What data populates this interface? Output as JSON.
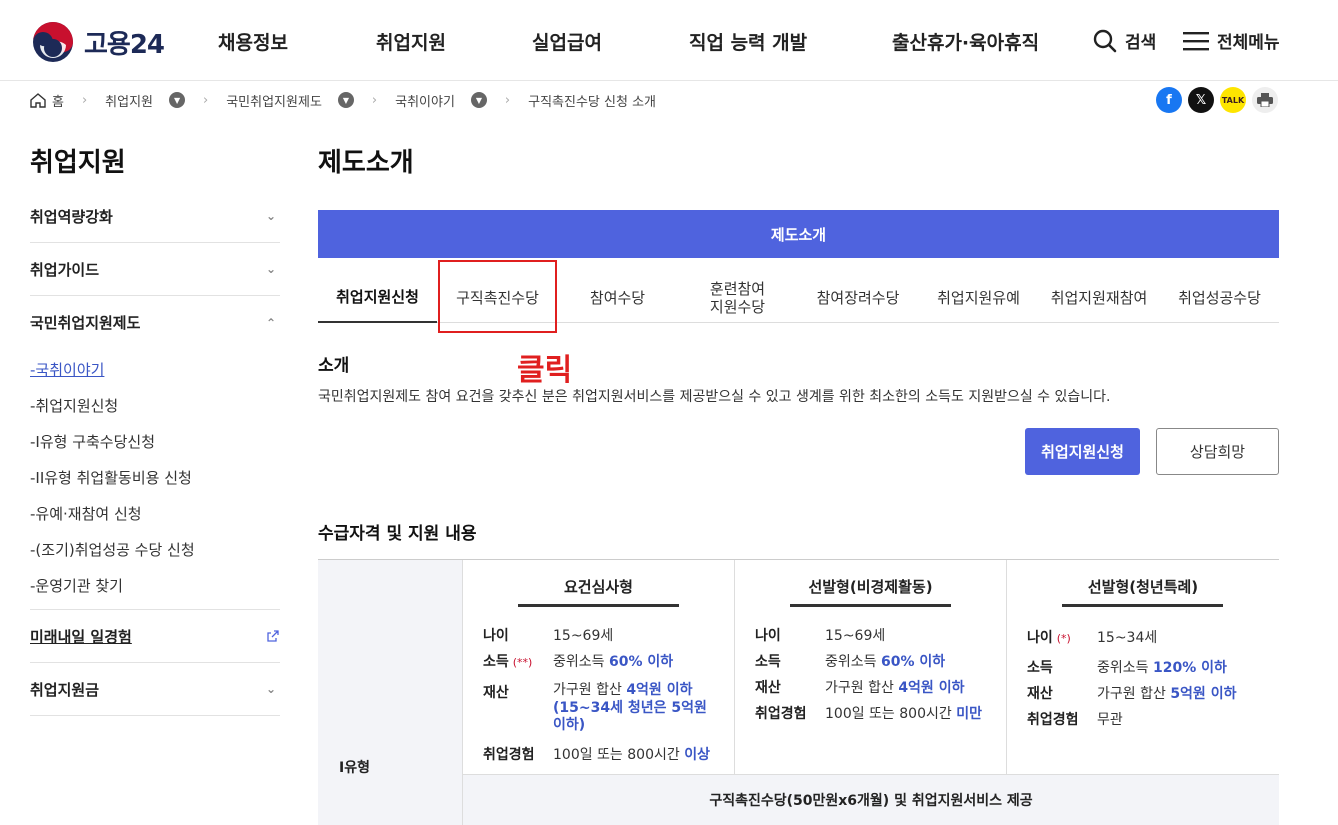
{
  "header": {
    "logo_text": "고용24",
    "nav": [
      "채용정보",
      "취업지원",
      "실업급여",
      "직업 능력 개발",
      "출산휴가·육아휴직"
    ],
    "search_label": "검색",
    "menu_label": "전체메뉴"
  },
  "breadcrumb": {
    "home": "홈",
    "items": [
      "취업지원",
      "국민취업지원제도",
      "국취이야기",
      "구직촉진수당 신청 소개"
    ]
  },
  "sidebar": {
    "title": "취업지원",
    "items": [
      {
        "label": "취업역량강화"
      },
      {
        "label": "취업가이드"
      },
      {
        "label": "국민취업지원제도"
      },
      {
        "label": "미래내일 일경험"
      },
      {
        "label": "취업지원금"
      }
    ],
    "sub_items": [
      "-국취이야기",
      "-취업지원신청",
      "-I유형 구축수당신청",
      "-II유형 취업활동비용 신청",
      "-유예·재참여 신청",
      "-(조기)취업성공 수당 신청",
      "-운영기관 찾기"
    ]
  },
  "main": {
    "title": "제도소개",
    "bar_label": "제도소개",
    "tabs": [
      "취업지원신청",
      "구직촉진수당",
      "참여수당",
      "훈련참여\n지원수당",
      "참여장려수당",
      "취업지원유예",
      "취업지원재참여",
      "취업성공수당"
    ],
    "annotation": "클릭",
    "intro_heading": "소개",
    "intro_text": "국민취업지원제도 참여 요건을 갖추신 분은 취업지원서비스를 제공받으실 수 있고 생계를 위한 최소한의 소득도 지원받으실 수 있습니다.",
    "apply_button": "취업지원신청",
    "consult_button": "상담희망",
    "qualification_heading": "수급자격 및 지원 내용"
  },
  "table": {
    "row_head": "I유형",
    "columns": [
      {
        "title": "요건심사형",
        "age_label": "나이",
        "age": "15~69세",
        "income_label": "소득",
        "income_mark": "(**)",
        "income_pre": "중위소득 ",
        "income_hl": "60% 이하",
        "asset_label": "재산",
        "asset_pre": "가구원 합산 ",
        "asset_hl": "4억원 이하",
        "asset_note": "(15~34세 청년은 5억원 이하)",
        "exp_label": "취업경험",
        "exp_pre": "100일 또는 800시간 ",
        "exp_hl": "이상"
      },
      {
        "title": "선발형(비경제활동)",
        "age_label": "나이",
        "age": "15~69세",
        "income_label": "소득",
        "income_pre": "중위소득 ",
        "income_hl": "60% 이하",
        "asset_label": "재산",
        "asset_pre": "가구원 합산 ",
        "asset_hl": "4억원 이하",
        "exp_label": "취업경험",
        "exp_pre": "100일 또는 800시간 ",
        "exp_hl": "미만"
      },
      {
        "title": "선발형(청년특례)",
        "age_label": "나이",
        "age_mark": "(*)",
        "age": "15~34세",
        "income_label": "소득",
        "income_pre": "중위소득 ",
        "income_hl": "120% 이하",
        "asset_label": "재산",
        "asset_pre": "가구원 합산 ",
        "asset_hl": "5억원 이하",
        "exp_label": "취업경험",
        "exp": "무관"
      }
    ],
    "footer": "구직촉진수당(50만원x6개월) 및 취업지원서비스 제공"
  },
  "colors": {
    "brand_blue": "#4f63de",
    "highlight_red": "#e01f1f",
    "link_blue": "#3a56c5"
  }
}
